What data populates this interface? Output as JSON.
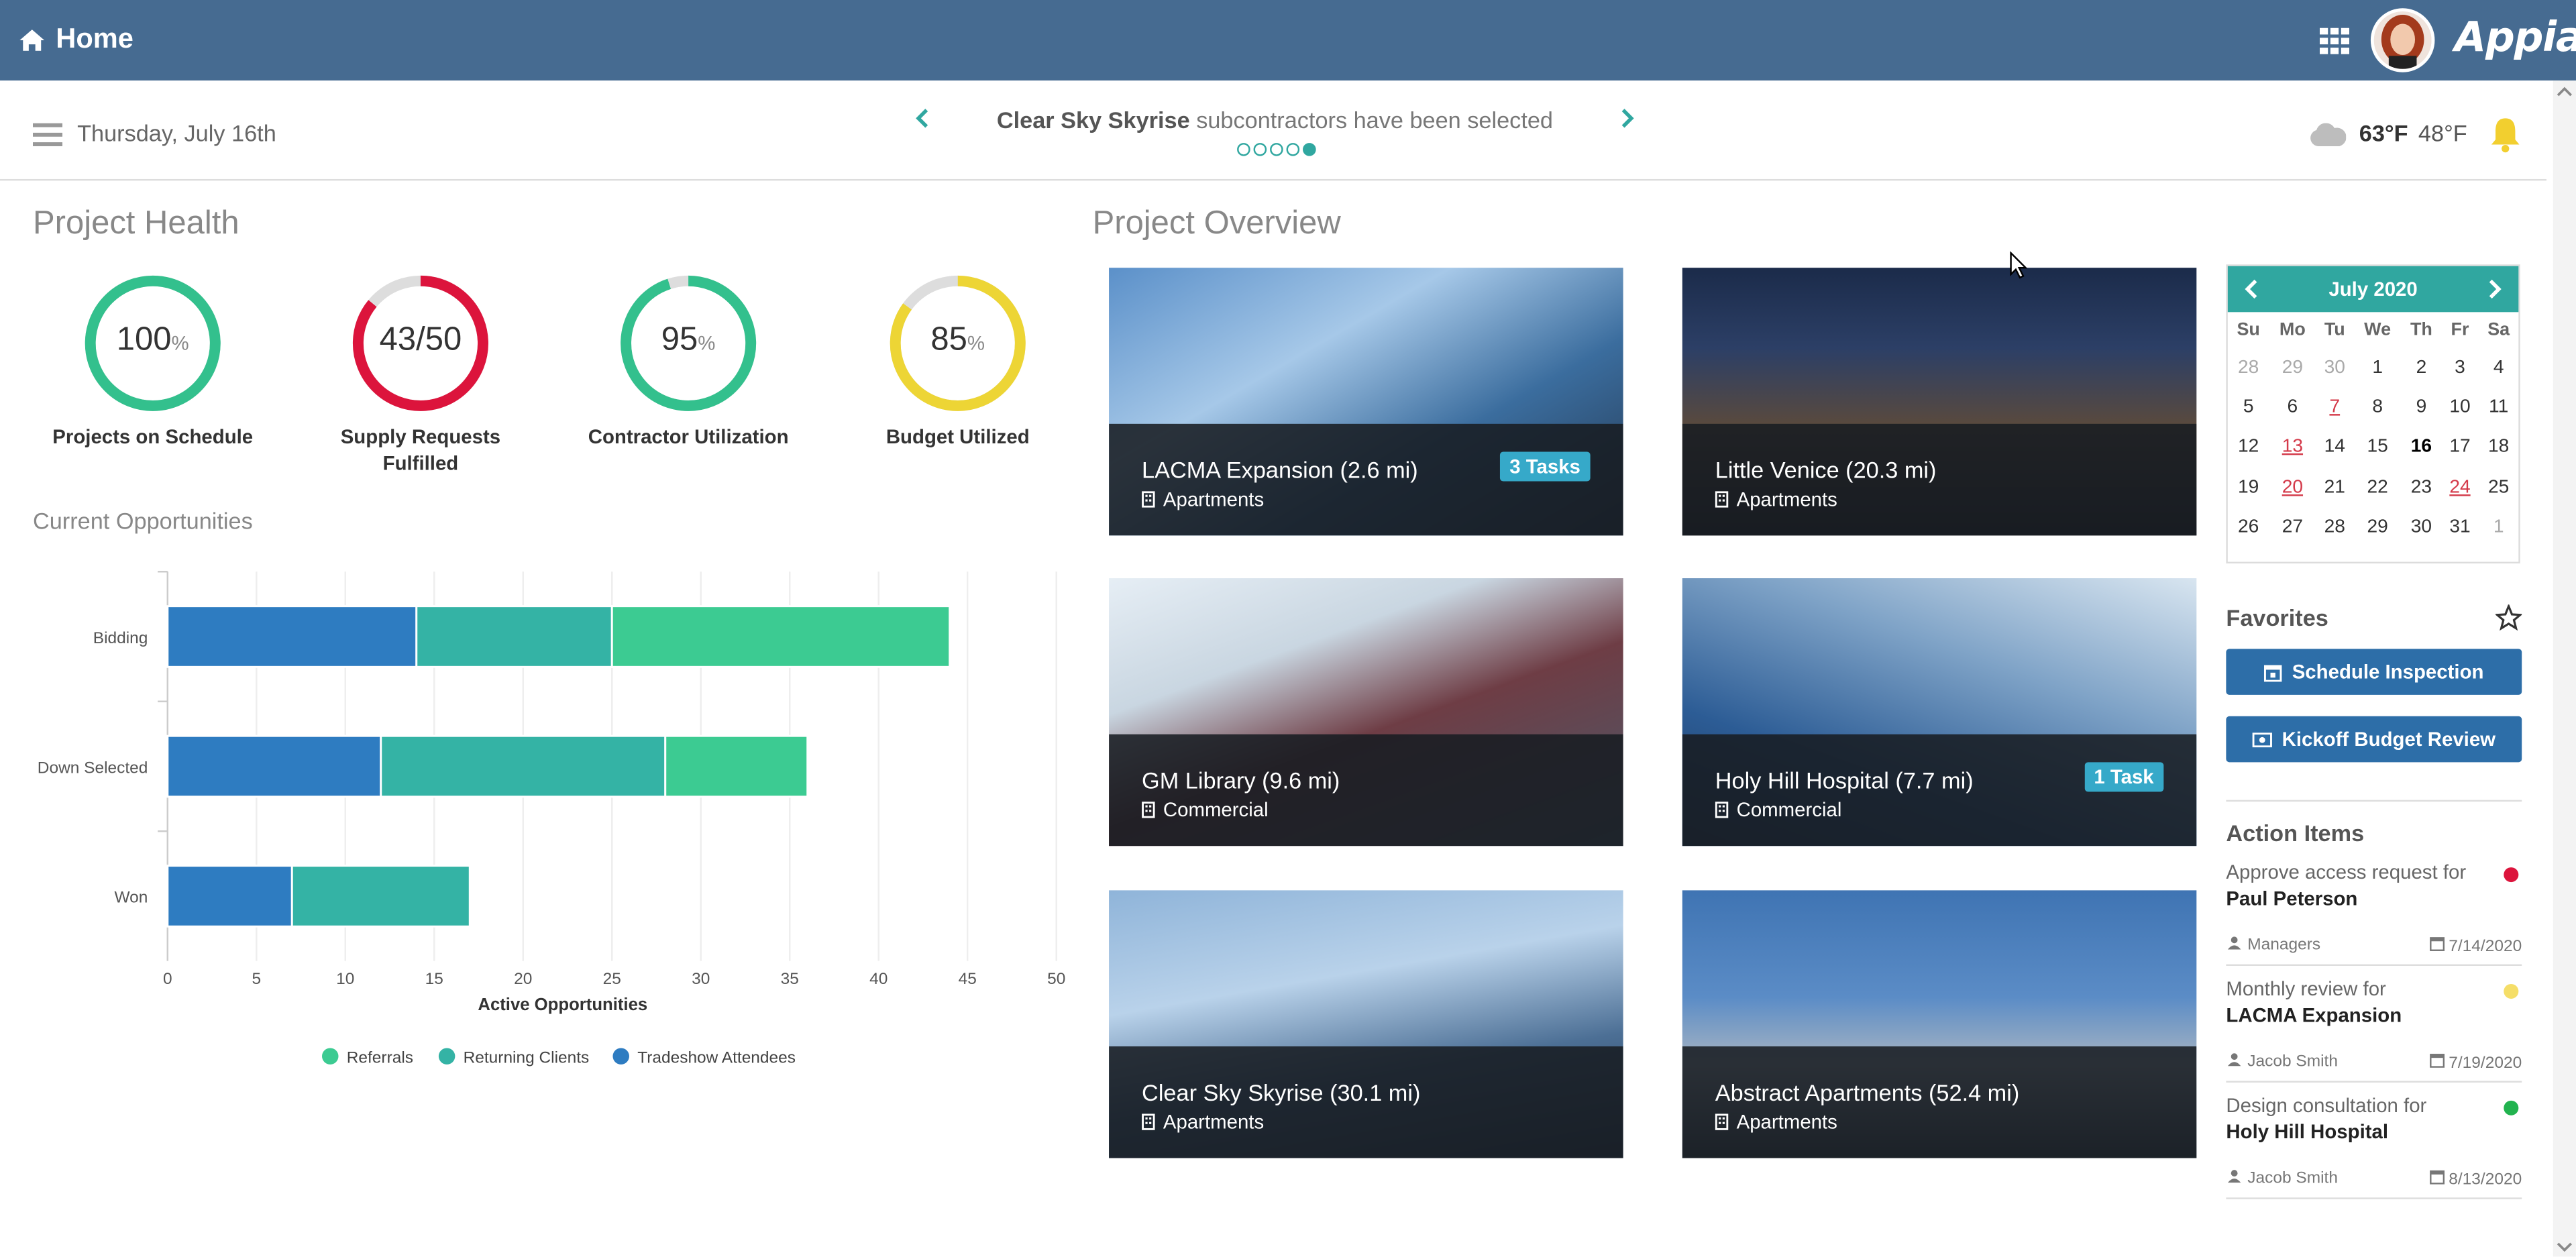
{
  "header": {
    "home_label": "Home",
    "brand": "Appian"
  },
  "strip": {
    "date": "Thursday, July 16th",
    "announcement_bold": "Clear Sky Skyrise",
    "announcement_rest": " subcontractors have been selected",
    "carousel_pages": 5,
    "carousel_active": 5,
    "weather_high": "63°F",
    "weather_low": "48°F"
  },
  "health": {
    "title": "Project Health",
    "gauges": [
      {
        "value": "100",
        "suffix": "%",
        "label": "Projects on Schedule",
        "fraction": 1.0,
        "color": "#33c08d"
      },
      {
        "value": "43/50",
        "suffix": "",
        "label": "Supply Requests Fulfilled",
        "fraction": 0.86,
        "color": "#dc143c"
      },
      {
        "value": "95",
        "suffix": "%",
        "label": "Contractor Utilization",
        "fraction": 0.95,
        "color": "#33c08d"
      },
      {
        "value": "85",
        "suffix": "%",
        "label": "Budget Utilized",
        "fraction": 0.85,
        "color": "#edd535"
      }
    ]
  },
  "opportunities": {
    "title": "Current Opportunities"
  },
  "chart_data": {
    "type": "bar",
    "orientation": "horizontal",
    "stacked": true,
    "categories": [
      "Bidding",
      "Down Selected",
      "Won"
    ],
    "series": [
      {
        "name": "Tradeshow Attendees",
        "color": "#2e7cc1",
        "values": [
          14,
          12,
          7
        ]
      },
      {
        "name": "Returning Clients",
        "color": "#34b3a5",
        "values": [
          11,
          16,
          10
        ]
      },
      {
        "name": "Referrals",
        "color": "#3ccb92",
        "values": [
          19,
          8,
          0
        ]
      }
    ],
    "xlabel": "Active Opportunities",
    "xlim": [
      0,
      50
    ],
    "xticks": [
      0,
      5,
      10,
      15,
      20,
      25,
      30,
      35,
      40,
      45,
      50
    ],
    "legend_order": [
      "Referrals",
      "Returning Clients",
      "Tradeshow Attendees"
    ],
    "legend_position": "bottom",
    "grid": true
  },
  "overview": {
    "title": "Project Overview",
    "projects": [
      {
        "name": "LACMA Expansion",
        "distance": "(2.6 mi)",
        "category": "Apartments",
        "badge": "3 Tasks"
      },
      {
        "name": "Little Venice",
        "distance": "(20.3 mi)",
        "category": "Apartments",
        "badge": ""
      },
      {
        "name": "GM Library",
        "distance": "(9.6 mi)",
        "category": "Commercial",
        "badge": ""
      },
      {
        "name": "Holy Hill Hospital",
        "distance": "(7.7 mi)",
        "category": "Commercial",
        "badge": "1 Task"
      },
      {
        "name": "Clear Sky Skyrise",
        "distance": "(30.1 mi)",
        "category": "Apartments",
        "badge": ""
      },
      {
        "name": "Abstract Apartments",
        "distance": "(52.4 mi)",
        "category": "Apartments",
        "badge": ""
      }
    ]
  },
  "calendar": {
    "month": "July 2020",
    "weekdays": [
      "Su",
      "Mo",
      "Tu",
      "We",
      "Th",
      "Fr",
      "Sa"
    ],
    "weeks": [
      [
        "28",
        "29",
        "30",
        "1",
        "2",
        "3",
        "4"
      ],
      [
        "5",
        "6",
        "7",
        "8",
        "9",
        "10",
        "11"
      ],
      [
        "12",
        "13",
        "14",
        "15",
        "16",
        "17",
        "18"
      ],
      [
        "19",
        "20",
        "21",
        "22",
        "23",
        "24",
        "25"
      ],
      [
        "26",
        "27",
        "28",
        "29",
        "30",
        "31",
        "1"
      ]
    ],
    "muted": [
      "28",
      "29",
      "30",
      "1"
    ],
    "highlighted": [
      "7",
      "13",
      "20",
      "24"
    ],
    "today": "16"
  },
  "favorites": {
    "title": "Favorites",
    "buttons": [
      "Schedule Inspection",
      "Kickoff Budget Review"
    ]
  },
  "actions": {
    "title": "Action Items",
    "items": [
      {
        "desc": "Approve access request for",
        "who": "Paul Peterson",
        "assignee": "Managers",
        "date": "7/14/2020",
        "color": "#dc143c"
      },
      {
        "desc": "Monthly review for",
        "who": "LACMA Expansion",
        "assignee": "Jacob Smith",
        "date": "7/19/2020",
        "color": "#f5de68"
      },
      {
        "desc": "Design consultation for",
        "who": "Holy Hill Hospital",
        "assignee": "Jacob Smith",
        "date": "8/13/2020",
        "color": "#22b34f"
      }
    ]
  },
  "icons": {
    "home": "home-icon",
    "apps": "grid-icon",
    "menu": "hamburger-icon",
    "weather": "cloud-icon",
    "notifications": "bell-icon",
    "favorite": "star-icon",
    "building": "building-icon",
    "calendar": "calendar-icon",
    "user": "user-icon",
    "group": "users-icon"
  }
}
